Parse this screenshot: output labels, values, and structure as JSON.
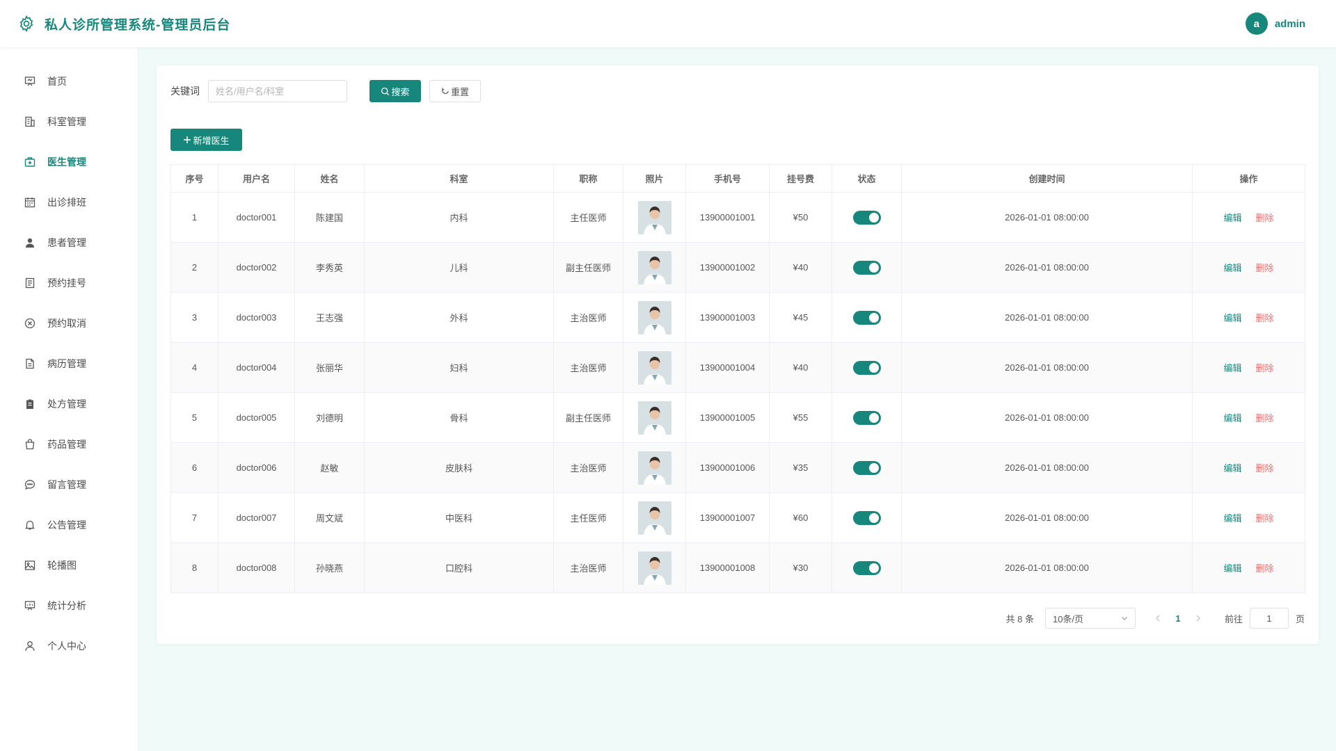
{
  "header": {
    "title": "私人诊所管理系统-管理员后台",
    "avatar_letter": "a",
    "username": "admin"
  },
  "colors": {
    "accent": "#17877c",
    "danger": "#f56c6c",
    "background": "#f0fbf9"
  },
  "sidebar": {
    "active": "医生管理",
    "items": [
      {
        "label": "首页",
        "icon": "dashboard-icon"
      },
      {
        "label": "科室管理",
        "icon": "building-icon"
      },
      {
        "label": "医生管理",
        "icon": "medical-kit-icon"
      },
      {
        "label": "出诊排班",
        "icon": "calendar-icon"
      },
      {
        "label": "患者管理",
        "icon": "user-icon"
      },
      {
        "label": "预约挂号",
        "icon": "document-icon"
      },
      {
        "label": "预约取消",
        "icon": "circle-close-icon"
      },
      {
        "label": "病历管理",
        "icon": "file-icon"
      },
      {
        "label": "处方管理",
        "icon": "clipboard-icon"
      },
      {
        "label": "药品管理",
        "icon": "bag-icon"
      },
      {
        "label": "留言管理",
        "icon": "chat-icon"
      },
      {
        "label": "公告管理",
        "icon": "bell-icon"
      },
      {
        "label": "轮播图",
        "icon": "picture-icon"
      },
      {
        "label": "统计分析",
        "icon": "data-board-icon"
      },
      {
        "label": "个人中心",
        "icon": "user-outline-icon"
      }
    ]
  },
  "search": {
    "label": "关键词",
    "placeholder": "姓名/用户名/科室",
    "search_button": "搜索",
    "reset_button": "重置",
    "add_button": "新增医生"
  },
  "table": {
    "columns": [
      "序号",
      "用户名",
      "姓名",
      "科室",
      "职称",
      "照片",
      "手机号",
      "挂号费",
      "状态",
      "创建时间",
      "操作"
    ],
    "edit_label": "编辑",
    "delete_label": "删除",
    "rows": [
      {
        "no": "1",
        "username": "doctor001",
        "name": "陈建国",
        "dept": "内科",
        "title": "主任医师",
        "phone": "13900001001",
        "fee": "¥50",
        "enabled": true,
        "created": "2026-01-01 08:00:00"
      },
      {
        "no": "2",
        "username": "doctor002",
        "name": "李秀英",
        "dept": "儿科",
        "title": "副主任医师",
        "phone": "13900001002",
        "fee": "¥40",
        "enabled": true,
        "created": "2026-01-01 08:00:00"
      },
      {
        "no": "3",
        "username": "doctor003",
        "name": "王志强",
        "dept": "外科",
        "title": "主治医师",
        "phone": "13900001003",
        "fee": "¥45",
        "enabled": true,
        "created": "2026-01-01 08:00:00"
      },
      {
        "no": "4",
        "username": "doctor004",
        "name": "张丽华",
        "dept": "妇科",
        "title": "主治医师",
        "phone": "13900001004",
        "fee": "¥40",
        "enabled": true,
        "created": "2026-01-01 08:00:00"
      },
      {
        "no": "5",
        "username": "doctor005",
        "name": "刘德明",
        "dept": "骨科",
        "title": "副主任医师",
        "phone": "13900001005",
        "fee": "¥55",
        "enabled": true,
        "created": "2026-01-01 08:00:00"
      },
      {
        "no": "6",
        "username": "doctor006",
        "name": "赵敏",
        "dept": "皮肤科",
        "title": "主治医师",
        "phone": "13900001006",
        "fee": "¥35",
        "enabled": true,
        "created": "2026-01-01 08:00:00"
      },
      {
        "no": "7",
        "username": "doctor007",
        "name": "周文斌",
        "dept": "中医科",
        "title": "主任医师",
        "phone": "13900001007",
        "fee": "¥60",
        "enabled": true,
        "created": "2026-01-01 08:00:00"
      },
      {
        "no": "8",
        "username": "doctor008",
        "name": "孙晓燕",
        "dept": "口腔科",
        "title": "主治医师",
        "phone": "13900001008",
        "fee": "¥30",
        "enabled": true,
        "created": "2026-01-01 08:00:00"
      }
    ]
  },
  "pagination": {
    "total_text": "共 8 条",
    "page_size": "10条/页",
    "current_page": "1",
    "goto_label": "前往",
    "goto_value": "1",
    "page_suffix": "页"
  }
}
